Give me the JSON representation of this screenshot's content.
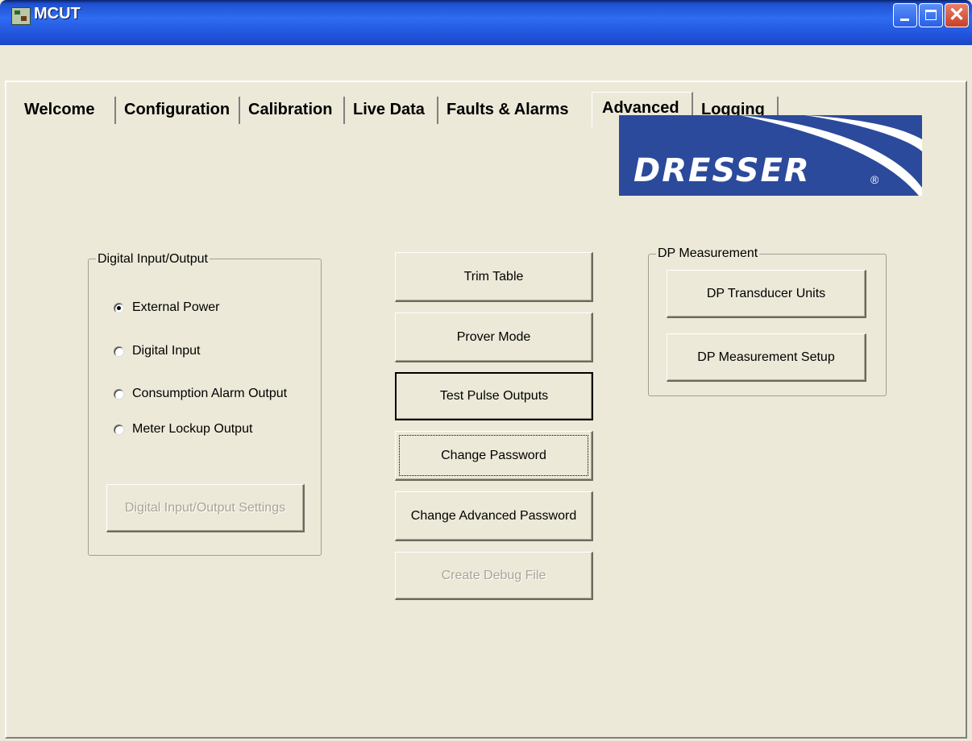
{
  "window": {
    "title": "MCUT",
    "close_glyph": "✕"
  },
  "tabs": [
    {
      "label": "Welcome"
    },
    {
      "label": "Configuration"
    },
    {
      "label": "Calibration"
    },
    {
      "label": "Live Data"
    },
    {
      "label": "Faults & Alarms"
    },
    {
      "label": "Advanced"
    },
    {
      "label": "Logging"
    }
  ],
  "active_tab": "Advanced",
  "logo": {
    "text": "DRESSER",
    "registered": "®"
  },
  "digital_io": {
    "title": "Digital Input/Output",
    "options": [
      {
        "label": "External Power",
        "checked": true
      },
      {
        "label": "Digital Input",
        "checked": false
      },
      {
        "label": "Consumption Alarm Output",
        "checked": false
      },
      {
        "label": "Meter Lockup Output",
        "checked": false
      }
    ],
    "settings_button": "Digital Input/Output Settings"
  },
  "center_buttons": {
    "trim_table": "Trim Table",
    "prover_mode": "Prover Mode",
    "test_pulse_outputs": "Test Pulse Outputs",
    "change_password": "Change Password",
    "change_advanced_password": "Change Advanced Password",
    "create_debug_file": "Create Debug File"
  },
  "dp_measurement": {
    "title": "DP Measurement",
    "transducer_units": "DP Transducer Units",
    "measurement_setup": "DP Measurement Setup"
  },
  "colors": {
    "window_bg": "#ece9d8",
    "titlebar": "#2e6cf0",
    "logo_bg": "#2b4a9c"
  }
}
